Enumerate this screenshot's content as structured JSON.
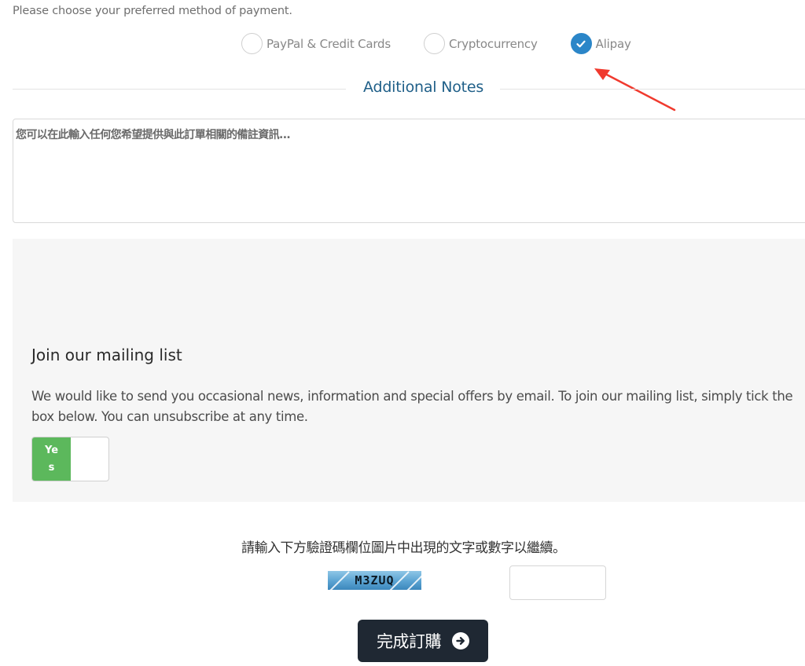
{
  "payment": {
    "intro": "Please choose your preferred method of payment.",
    "options": [
      {
        "label": "PayPal & Credit Cards",
        "selected": false
      },
      {
        "label": "Cryptocurrency",
        "selected": false
      },
      {
        "label": "Alipay",
        "selected": true
      }
    ],
    "accent_color": "#2b86c8"
  },
  "annotation": {
    "icon": "red-arrow-icon",
    "points_to": "Alipay",
    "color": "#f03a2e"
  },
  "notes": {
    "section_title": "Additional Notes",
    "placeholder": "您可以在此輸入任何您希望提供與此訂單相關的備註資訊...",
    "value": ""
  },
  "mailing_list": {
    "title": "Join our mailing list",
    "description": "We would like to send you occasional news, information and special offers by email. To join our mailing list, simply tick the box below. You can unsubscribe at any time.",
    "toggle_label": "Yes",
    "toggle_on": true,
    "toggle_color": "#5cb85c"
  },
  "captcha": {
    "instruction": "請輸入下方驗證碼欄位圖片中出現的文字或數字以繼續。",
    "image_text": "M3ZUQ",
    "input_value": ""
  },
  "submit": {
    "label": "完成訂購",
    "icon": "arrow-circle-right-icon",
    "background": "#1f2833"
  }
}
